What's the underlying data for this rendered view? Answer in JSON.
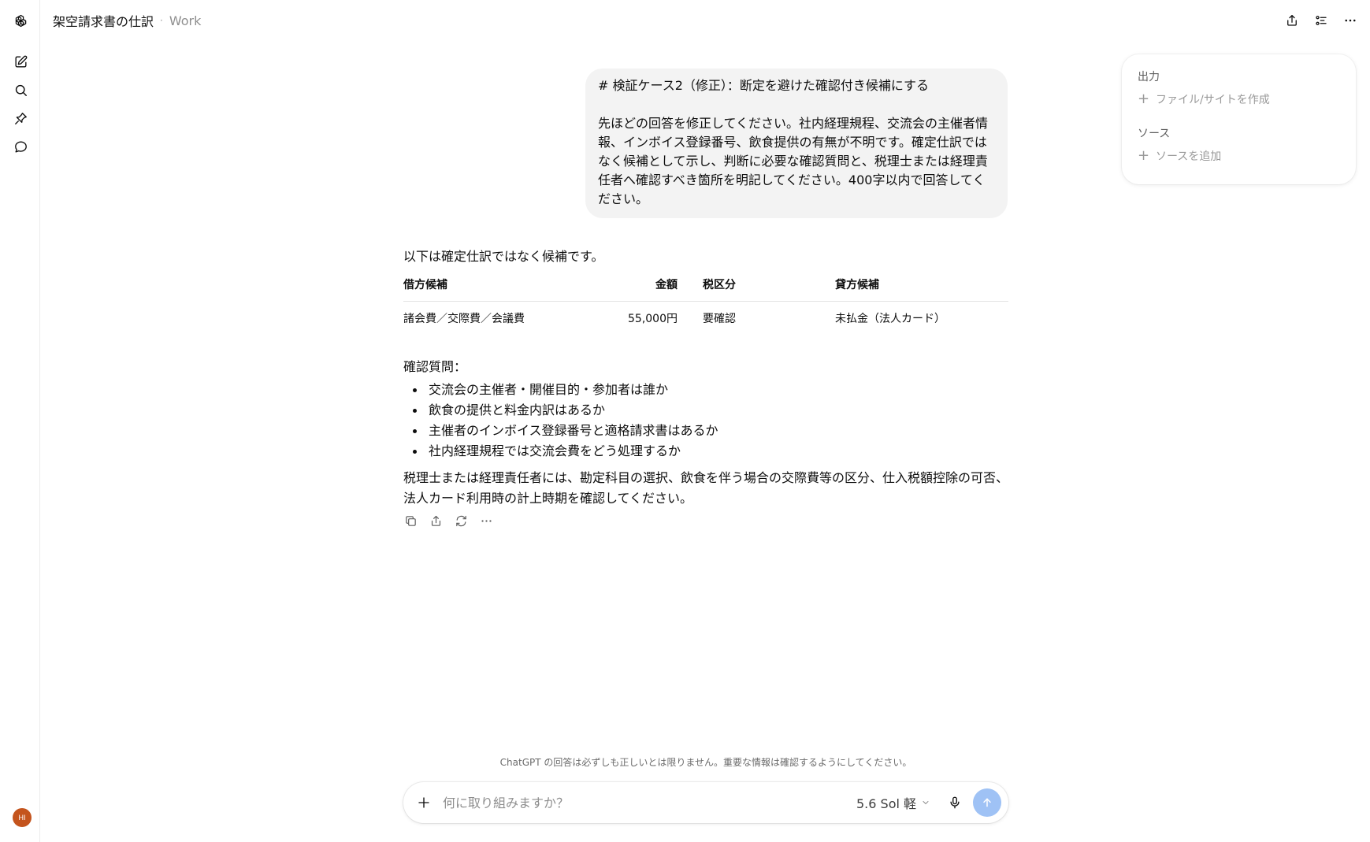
{
  "header": {
    "title": "架空請求書の仕訳",
    "separator": "·",
    "project": "Work"
  },
  "sidebar": {
    "items": [
      {
        "icon": "openai-logo-icon"
      },
      {
        "icon": "new-chat-icon"
      },
      {
        "icon": "search-icon"
      },
      {
        "icon": "pin-icon"
      },
      {
        "icon": "chat-bubble-icon"
      }
    ],
    "avatar_initials": "HI"
  },
  "right_panel": {
    "output_heading": "出力",
    "output_action": "ファイル/サイトを作成",
    "sources_heading": "ソース",
    "sources_action": "ソースを追加"
  },
  "user_message": {
    "heading": "# 検証ケース2（修正）：断定を避けた確認付き候補にする",
    "body": "先ほどの回答を修正してください。社内経理規程、交流会の主催者情報、インボイス登録番号、飲食提供の有無が不明です。確定仕訳ではなく候補として示し、判断に必要な確認質問と、税理士または経理責任者へ確認すべき箇所を明記してください。400字以内で回答してください。"
  },
  "assistant_message": {
    "intro": "以下は確定仕訳ではなく候補です。",
    "table": {
      "headers": [
        "借方候補",
        "金額",
        "税区分",
        "貸方候補"
      ],
      "rows": [
        [
          "諸会費／交際費／会議費",
          "55,000円",
          "要確認",
          "未払金（法人カード）"
        ]
      ]
    },
    "questions_label": "確認質問：",
    "questions": [
      "交流会の主催者・開催目的・参加者は誰か",
      "飲食の提供と料金内訳はあるか",
      "主催者のインボイス登録番号と適格請求書はあるか",
      "社内経理規程では交流会費をどう処理するか"
    ],
    "closing": "税理士または経理責任者には、勘定科目の選択、飲食を伴う場合の交際費等の区分、仕入税額控除の可否、法人カード利用時の計上時期を確認してください。"
  },
  "disclaimer": "ChatGPT の回答は必ずしも正しいとは限りません。重要な情報は確認するようにしてください。",
  "composer": {
    "placeholder": "何に取り組みますか？",
    "model_label": "5.6 Sol 軽"
  },
  "colors": {
    "send_button": "#9fc2f5",
    "avatar": "#c4541d",
    "bubble": "#f3f3f3"
  }
}
